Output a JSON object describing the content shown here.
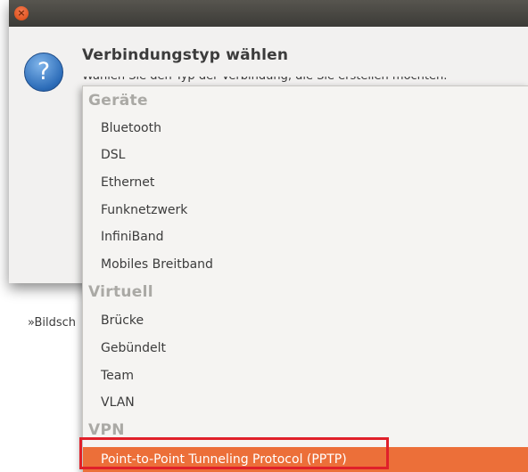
{
  "dialog": {
    "title": "Verbindungstyp wählen",
    "description": "Wählen Sie den Typ der Verbindung, die Sie erstellen möchten.",
    "hint": "»Bildsch",
    "close_glyph": "×",
    "icon_glyph": "?"
  },
  "menu": {
    "sections": [
      {
        "label": "Geräte",
        "items": [
          "Bluetooth",
          "DSL",
          "Ethernet",
          "Funknetzwerk",
          "InfiniBand",
          "Mobiles Breitband"
        ]
      },
      {
        "label": "Virtuell",
        "items": [
          "Brücke",
          "Gebündelt",
          "Team",
          "VLAN"
        ]
      },
      {
        "label": "VPN",
        "items": [
          "Point-to-Point Tunneling Protocol (PPTP)"
        ]
      }
    ],
    "selected": "Point-to-Point Tunneling Protocol (PPTP)"
  },
  "colors": {
    "selection": "#ec6f39",
    "annotation_box": "#e0202a",
    "titlebar": "#3c3b37"
  }
}
